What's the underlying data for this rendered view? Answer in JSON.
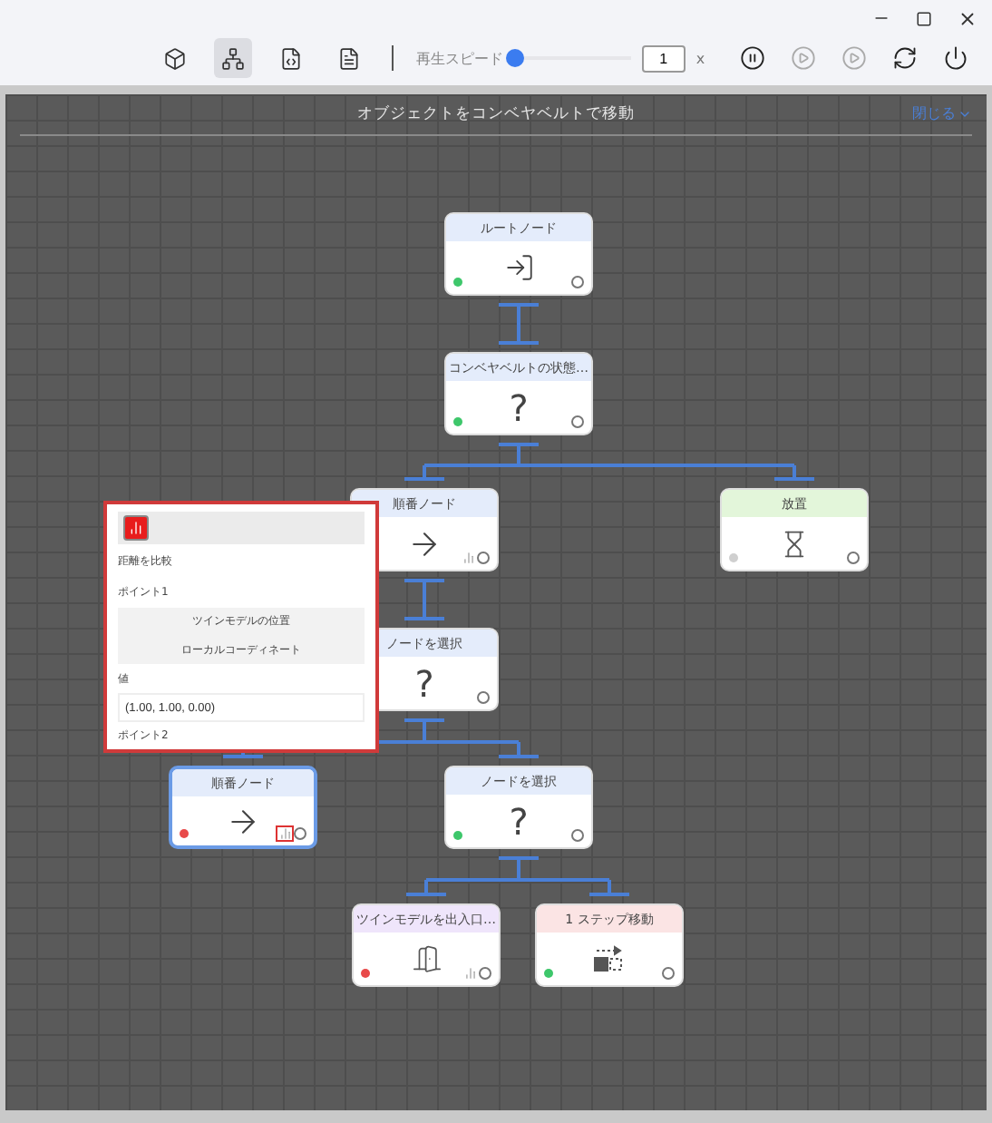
{
  "toolbar": {
    "tools": [
      {
        "kind": "model",
        "selected": false
      },
      {
        "kind": "tree",
        "selected": true
      },
      {
        "kind": "code",
        "selected": false
      },
      {
        "kind": "document",
        "selected": false
      }
    ],
    "speed": {
      "label": "再生スピード",
      "level": 0.0,
      "value": "1",
      "unit": "x"
    },
    "controls": [
      {
        "kind": "pause",
        "disabled": false
      },
      {
        "kind": "step",
        "disabled": true
      },
      {
        "kind": "play",
        "disabled": true
      },
      {
        "kind": "reset",
        "disabled": false
      },
      {
        "kind": "power",
        "disabled": false
      }
    ]
  },
  "canvas": {
    "title": "オブジェクトをコンベヤベルトで移動",
    "close_label": "閉じる",
    "tree": {
      "title": "ルートノード",
      "kind": "root",
      "color": "#3ec76b",
      "selected": false,
      "children": [
        {
          "title": "コンベヤベルトの状態…",
          "kind": "select",
          "symbol": "?",
          "color": "#3ec76b",
          "selected": false,
          "children": [
            {
              "title": "順番ノード",
              "kind": "sequence",
              "marked": true,
              "selected": false,
              "children": [
                {
                  "title": "ノードを選択",
                  "kind": "select",
                  "symbol": "?",
                  "selected": false,
                  "children": [
                    {
                      "title": "順番ノード",
                      "kind": "sequence",
                      "color": "#e84a4a",
                      "marked": true,
                      "highlighted": true,
                      "selected": true
                    },
                    {
                      "title": "ノードを選択",
                      "kind": "select",
                      "symbol": "?",
                      "color": "#3ec76b",
                      "selected": false,
                      "children": [
                        {
                          "title": "ツインモデルを出入口…",
                          "kind": "door",
                          "color": "#e84a4a",
                          "marked": true,
                          "selected": false
                        },
                        {
                          "title": "1 ステップ移動",
                          "kind": "move",
                          "color": "#3ec76b",
                          "selected": false
                        }
                      ]
                    }
                  ]
                }
              ]
            },
            {
              "title": "放置",
              "kind": "wait",
              "color": "#cfcfcf",
              "selected": false
            }
          ]
        }
      ]
    },
    "popup": {
      "title": "距離を比較",
      "point1_label": "ポイント1",
      "point1_options": [
        "ツインモデルの位置",
        "ローカルコーディネート"
      ],
      "value_label": "値",
      "value": "(1.00, 1.00, 0.00)",
      "point2_label": "ポイント2"
    }
  }
}
